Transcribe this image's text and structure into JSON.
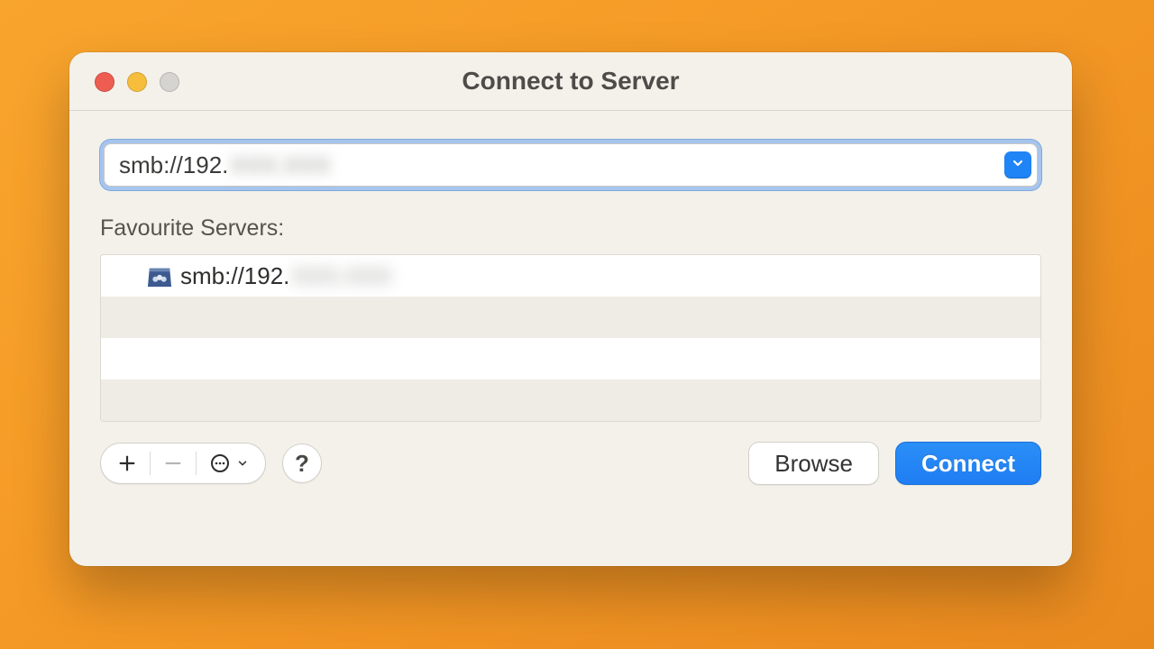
{
  "window": {
    "title": "Connect to Server"
  },
  "address": {
    "prefix": "smb://192.",
    "obscured": "XXX.XXX"
  },
  "favourites": {
    "label": "Favourite Servers:",
    "items": [
      {
        "prefix": "smb://192.",
        "obscured": "XXX.XXX",
        "icon": "server-icon"
      }
    ]
  },
  "toolbar": {
    "add_title": "Add",
    "remove_title": "Remove",
    "actions_title": "Actions",
    "help_title": "Help"
  },
  "buttons": {
    "browse": "Browse",
    "connect": "Connect"
  },
  "glyphs": {
    "help": "?"
  }
}
